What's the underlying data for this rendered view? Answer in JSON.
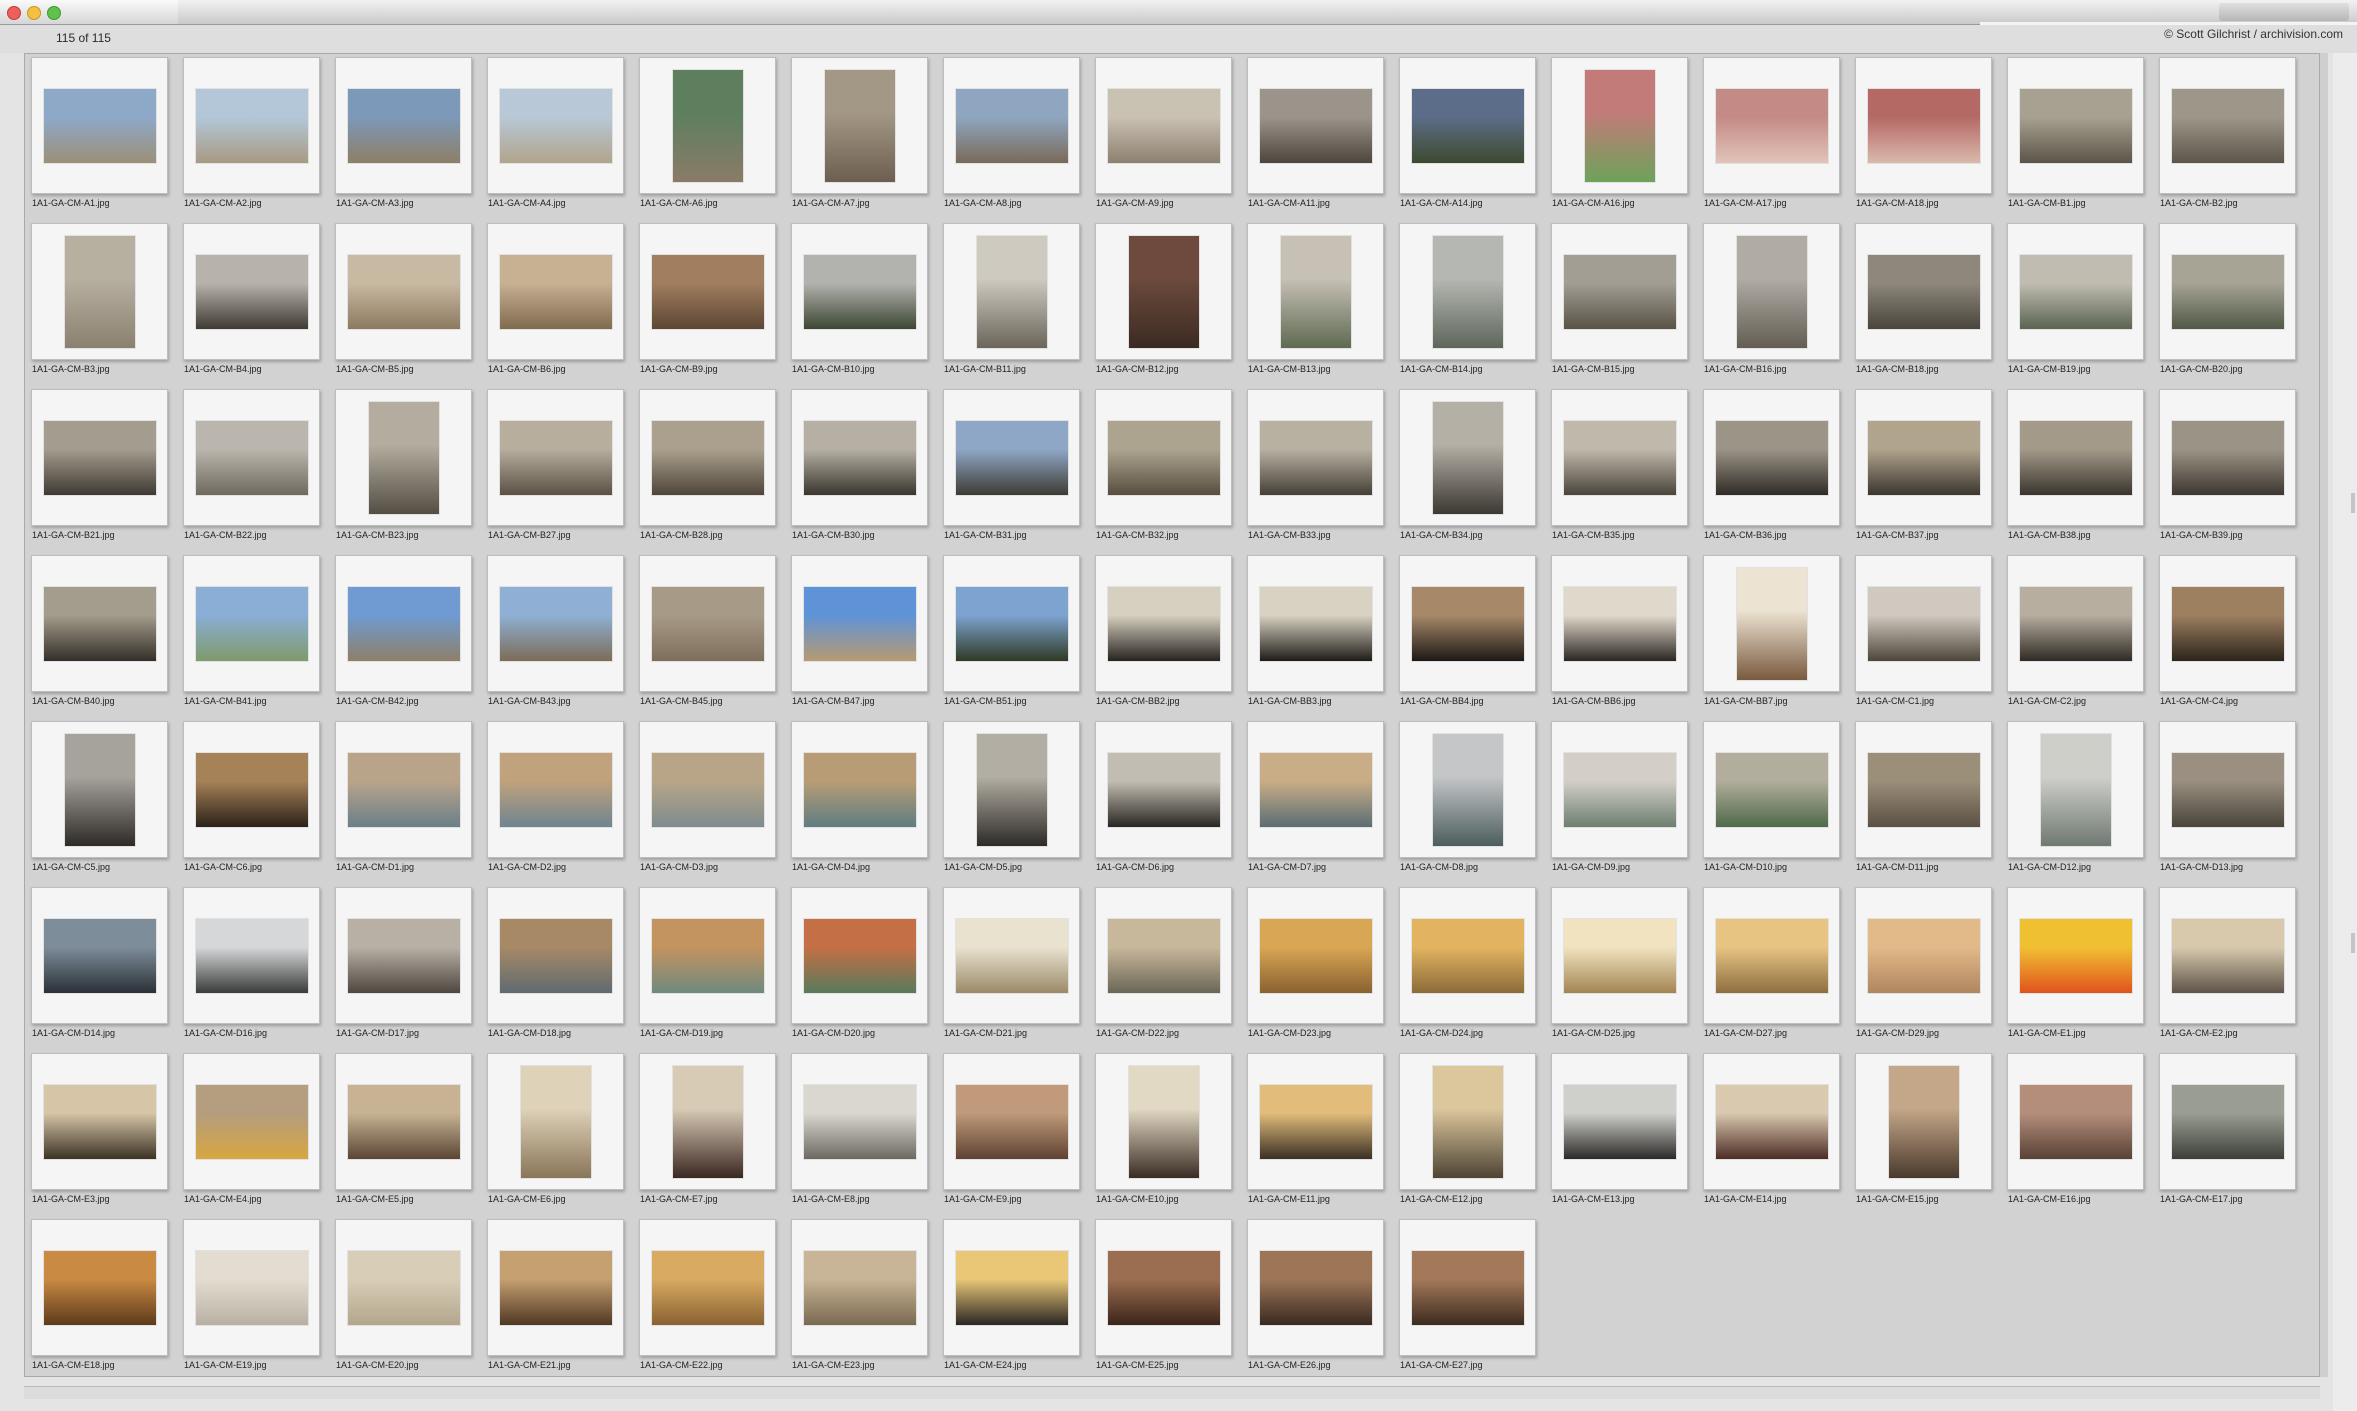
{
  "window": {
    "count_label": "115 of 115",
    "credit": "© Scott Gilchrist / archivision.com"
  },
  "thumbnails": [
    {
      "name": "1A1-GA-CM-A1.jpg",
      "c1": "#8ea9c8",
      "c2": "#9b8f78",
      "o": "l"
    },
    {
      "name": "1A1-GA-CM-A2.jpg",
      "c1": "#b3c7d8",
      "c2": "#a89a82",
      "o": "l"
    },
    {
      "name": "1A1-GA-CM-A3.jpg",
      "c1": "#7c99b9",
      "c2": "#8d7f66",
      "o": "l"
    },
    {
      "name": "1A1-GA-CM-A4.jpg",
      "c1": "#b8c8d6",
      "c2": "#b0a48c",
      "o": "l"
    },
    {
      "name": "1A1-GA-CM-A6.jpg",
      "c1": "#5d7f5e",
      "c2": "#8a7b68",
      "o": "p"
    },
    {
      "name": "1A1-GA-CM-A7.jpg",
      "c1": "#a39785",
      "c2": "#6d5f50",
      "o": "p"
    },
    {
      "name": "1A1-GA-CM-A8.jpg",
      "c1": "#8ea6c0",
      "c2": "#7a6a58",
      "o": "l"
    },
    {
      "name": "1A1-GA-CM-A9.jpg",
      "c1": "#c9c1b2",
      "c2": "#8d8070",
      "o": "l"
    },
    {
      "name": "1A1-GA-CM-A11.jpg",
      "c1": "#9b948a",
      "c2": "#4e463c",
      "o": "l"
    },
    {
      "name": "1A1-GA-CM-A14.jpg",
      "c1": "#5b6d88",
      "c2": "#3d4a2e",
      "o": "l"
    },
    {
      "name": "1A1-GA-CM-A16.jpg",
      "c1": "#c27b78",
      "c2": "#6da25a",
      "o": "p"
    },
    {
      "name": "1A1-GA-CM-A17.jpg",
      "c1": "#c48a86",
      "c2": "#e1c4b8",
      "o": "l"
    },
    {
      "name": "1A1-GA-CM-A18.jpg",
      "c1": "#b56965",
      "c2": "#dab9ac",
      "o": "l"
    },
    {
      "name": "1A1-GA-CM-B1.jpg",
      "c1": "#a8a090",
      "c2": "#5c5448",
      "o": "l"
    },
    {
      "name": "1A1-GA-CM-B2.jpg",
      "c1": "#9c9789",
      "c2": "#5c564a",
      "o": "l"
    },
    {
      "name": "1A1-GA-CM-B3.jpg",
      "c1": "#b7afa0",
      "c2": "#8a8170",
      "o": "p"
    },
    {
      "name": "1A1-GA-CM-B4.jpg",
      "c1": "#b8b3aa",
      "c2": "#3f3a33",
      "o": "l"
    },
    {
      "name": "1A1-GA-CM-B5.jpg",
      "c1": "#c8b9a2",
      "c2": "#8d7a60",
      "o": "l"
    },
    {
      "name": "1A1-GA-CM-B6.jpg",
      "c1": "#c7b193",
      "c2": "#806b4f",
      "o": "l"
    },
    {
      "name": "1A1-GA-CM-B9.jpg",
      "c1": "#a07e5f",
      "c2": "#5d4633",
      "o": "l"
    },
    {
      "name": "1A1-GA-CM-B10.jpg",
      "c1": "#b2b2ae",
      "c2": "#3d4732",
      "o": "l"
    },
    {
      "name": "1A1-GA-CM-B11.jpg",
      "c1": "#cfcac0",
      "c2": "#6b655a",
      "o": "p"
    },
    {
      "name": "1A1-GA-CM-B12.jpg",
      "c1": "#6d4a3d",
      "c2": "#3b2a22",
      "o": "p"
    },
    {
      "name": "1A1-GA-CM-B13.jpg",
      "c1": "#c6c0b5",
      "c2": "#5f6a52",
      "o": "p"
    },
    {
      "name": "1A1-GA-CM-B14.jpg",
      "c1": "#b5b8b2",
      "c2": "#5e665a",
      "o": "p"
    },
    {
      "name": "1A1-GA-CM-B15.jpg",
      "c1": "#a29e94",
      "c2": "#595246",
      "o": "l"
    },
    {
      "name": "1A1-GA-CM-B16.jpg",
      "c1": "#b0aca3",
      "c2": "#635d54",
      "o": "p"
    },
    {
      "name": "1A1-GA-CM-B18.jpg",
      "c1": "#8d877c",
      "c2": "#4a453d",
      "o": "l"
    },
    {
      "name": "1A1-GA-CM-B19.jpg",
      "c1": "#c1bcb1",
      "c2": "#5a6451",
      "o": "l"
    },
    {
      "name": "1A1-GA-CM-B20.jpg",
      "c1": "#a7a395",
      "c2": "#4f5a45",
      "o": "l"
    },
    {
      "name": "1A1-GA-CM-B21.jpg",
      "c1": "#a39c8f",
      "c2": "#3f3a33",
      "o": "l"
    },
    {
      "name": "1A1-GA-CM-B22.jpg",
      "c1": "#bab6ad",
      "c2": "#6f6a60",
      "o": "l"
    },
    {
      "name": "1A1-GA-CM-B23.jpg",
      "c1": "#b4ad9f",
      "c2": "#544e44",
      "o": "p"
    },
    {
      "name": "1A1-GA-CM-B27.jpg",
      "c1": "#b7ae9e",
      "c2": "#5b5145",
      "o": "l"
    },
    {
      "name": "1A1-GA-CM-B28.jpg",
      "c1": "#aaa08d",
      "c2": "#4f463a",
      "o": "l"
    },
    {
      "name": "1A1-GA-CM-B30.jpg",
      "c1": "#b6b0a4",
      "c2": "#39362f",
      "o": "l"
    },
    {
      "name": "1A1-GA-CM-B31.jpg",
      "c1": "#8fa7c6",
      "c2": "#3e3b35",
      "o": "l"
    },
    {
      "name": "1A1-GA-CM-B32.jpg",
      "c1": "#ada48f",
      "c2": "#584e40",
      "o": "l"
    },
    {
      "name": "1A1-GA-CM-B33.jpg",
      "c1": "#b8b1a2",
      "c2": "#454037",
      "o": "l"
    },
    {
      "name": "1A1-GA-CM-B34.jpg",
      "c1": "#b5b0a6",
      "c2": "#3c3832",
      "o": "p"
    },
    {
      "name": "1A1-GA-CM-B35.jpg",
      "c1": "#c0b9ab",
      "c2": "#4a453c",
      "o": "l"
    },
    {
      "name": "1A1-GA-CM-B36.jpg",
      "c1": "#9c9487",
      "c2": "#2f2b26",
      "o": "l"
    },
    {
      "name": "1A1-GA-CM-B37.jpg",
      "c1": "#b1a48d",
      "c2": "#3b3630",
      "o": "l"
    },
    {
      "name": "1A1-GA-CM-B38.jpg",
      "c1": "#a39a89",
      "c2": "#3a352e",
      "o": "l"
    },
    {
      "name": "1A1-GA-CM-B39.jpg",
      "c1": "#9b9486",
      "c2": "#3c3731",
      "o": "l"
    },
    {
      "name": "1A1-GA-CM-B40.jpg",
      "c1": "#a49c8c",
      "c2": "#332f29",
      "o": "l"
    },
    {
      "name": "1A1-GA-CM-B41.jpg",
      "c1": "#8aaed6",
      "c2": "#7f9a6a",
      "o": "l"
    },
    {
      "name": "1A1-GA-CM-B42.jpg",
      "c1": "#6f9bd2",
      "c2": "#8e7f69",
      "o": "l"
    },
    {
      "name": "1A1-GA-CM-B43.jpg",
      "c1": "#8fb0d4",
      "c2": "#7c6c57",
      "o": "l"
    },
    {
      "name": "1A1-GA-CM-B45.jpg",
      "c1": "#a79a86",
      "c2": "#7e6f5c",
      "o": "l"
    },
    {
      "name": "1A1-GA-CM-B47.jpg",
      "c1": "#5e93d8",
      "c2": "#b79a72",
      "o": "l"
    },
    {
      "name": "1A1-GA-CM-B51.jpg",
      "c1": "#7da3d0",
      "c2": "#2f3a25",
      "o": "l"
    },
    {
      "name": "1A1-GA-CM-BB2.jpg",
      "c1": "#d7d0c0",
      "c2": "#27231f",
      "o": "l"
    },
    {
      "name": "1A1-GA-CM-BB3.jpg",
      "c1": "#d9d2c3",
      "c2": "#1f1c19",
      "o": "l"
    },
    {
      "name": "1A1-GA-CM-BB4.jpg",
      "c1": "#a7896a",
      "c2": "#1d1915",
      "o": "l"
    },
    {
      "name": "1A1-GA-CM-BB6.jpg",
      "c1": "#e0d9cb",
      "c2": "#2b2723",
      "o": "l"
    },
    {
      "name": "1A1-GA-CM-BB7.jpg",
      "c1": "#ece3d2",
      "c2": "#7a5a3e",
      "o": "p"
    },
    {
      "name": "1A1-GA-CM-C1.jpg",
      "c1": "#cfc9bf",
      "c2": "#4e463b",
      "o": "l"
    },
    {
      "name": "1A1-GA-CM-C2.jpg",
      "c1": "#b7aea0",
      "c2": "#2f2a24",
      "o": "l"
    },
    {
      "name": "1A1-GA-CM-C4.jpg",
      "c1": "#9d8060",
      "c2": "#2c241c",
      "o": "l"
    },
    {
      "name": "1A1-GA-CM-C5.jpg",
      "c1": "#a6a39d",
      "c2": "#2e2b27",
      "o": "p"
    },
    {
      "name": "1A1-GA-CM-C6.jpg",
      "c1": "#a58258",
      "c2": "#2c2219",
      "o": "l"
    },
    {
      "name": "1A1-GA-CM-D1.jpg",
      "c1": "#b9a48a",
      "c2": "#6b7f88",
      "o": "l"
    },
    {
      "name": "1A1-GA-CM-D2.jpg",
      "c1": "#c0a27c",
      "c2": "#6f8490",
      "o": "l"
    },
    {
      "name": "1A1-GA-CM-D3.jpg",
      "c1": "#b8a588",
      "c2": "#7e8c8e",
      "o": "l"
    },
    {
      "name": "1A1-GA-CM-D4.jpg",
      "c1": "#b89c76",
      "c2": "#5f7d82",
      "o": "l"
    },
    {
      "name": "1A1-GA-CM-D5.jpg",
      "c1": "#b3aea3",
      "c2": "#2e2b27",
      "o": "p"
    },
    {
      "name": "1A1-GA-CM-D6.jpg",
      "c1": "#c2bdb2",
      "c2": "#2a2723",
      "o": "l"
    },
    {
      "name": "1A1-GA-CM-D7.jpg",
      "c1": "#c9ad86",
      "c2": "#5b6d74",
      "o": "l"
    },
    {
      "name": "1A1-GA-CM-D8.jpg",
      "c1": "#c4c6c8",
      "c2": "#4d5e5d",
      "o": "p"
    },
    {
      "name": "1A1-GA-CM-D9.jpg",
      "c1": "#d3cfc7",
      "c2": "#6c7f6f",
      "o": "l"
    },
    {
      "name": "1A1-GA-CM-D10.jpg",
      "c1": "#b2ad9c",
      "c2": "#4f6a4b",
      "o": "l"
    },
    {
      "name": "1A1-GA-CM-D11.jpg",
      "c1": "#9b8f7a",
      "c2": "#5b5043",
      "o": "l"
    },
    {
      "name": "1A1-GA-CM-D12.jpg",
      "c1": "#cfcfca",
      "c2": "#6f7972",
      "o": "p"
    },
    {
      "name": "1A1-GA-CM-D13.jpg",
      "c1": "#9a8f80",
      "c2": "#4a443b",
      "o": "l"
    },
    {
      "name": "1A1-GA-CM-D14.jpg",
      "c1": "#7d8d9a",
      "c2": "#2b3036",
      "o": "l"
    },
    {
      "name": "1A1-GA-CM-D16.jpg",
      "c1": "#d6d7d8",
      "c2": "#3a3b3b",
      "o": "l"
    },
    {
      "name": "1A1-GA-CM-D17.jpg",
      "c1": "#b8b0a5",
      "c2": "#4e4740",
      "o": "l"
    },
    {
      "name": "1A1-GA-CM-D18.jpg",
      "c1": "#a78966",
      "c2": "#5f6b70",
      "o": "l"
    },
    {
      "name": "1A1-GA-CM-D19.jpg",
      "c1": "#c39360",
      "c2": "#6f8a7e",
      "o": "l"
    },
    {
      "name": "1A1-GA-CM-D20.jpg",
      "c1": "#c46f45",
      "c2": "#597a5b",
      "o": "l"
    },
    {
      "name": "1A1-GA-CM-D21.jpg",
      "c1": "#e8e2cf",
      "c2": "#9b8a68",
      "o": "l"
    },
    {
      "name": "1A1-GA-CM-D22.jpg",
      "c1": "#c8b89b",
      "c2": "#6b6656",
      "o": "l"
    },
    {
      "name": "1A1-GA-CM-D23.jpg",
      "c1": "#d9a654",
      "c2": "#8a6231",
      "o": "l"
    },
    {
      "name": "1A1-GA-CM-D24.jpg",
      "c1": "#e2b460",
      "c2": "#8c6b3a",
      "o": "l"
    },
    {
      "name": "1A1-GA-CM-D25.jpg",
      "c1": "#f1e3c0",
      "c2": "#a38552",
      "o": "l"
    },
    {
      "name": "1A1-GA-CM-D27.jpg",
      "c1": "#e8c483",
      "c2": "#8e6d41",
      "o": "l"
    },
    {
      "name": "1A1-GA-CM-D29.jpg",
      "c1": "#e2b988",
      "c2": "#b08660",
      "o": "l"
    },
    {
      "name": "1A1-GA-CM-E1.jpg",
      "c1": "#f0c033",
      "c2": "#e0531c",
      "o": "l"
    },
    {
      "name": "1A1-GA-CM-E2.jpg",
      "c1": "#d8c9ad",
      "c2": "#5d5347",
      "o": "l"
    },
    {
      "name": "1A1-GA-CM-E3.jpg",
      "c1": "#d6c5a6",
      "c2": "#3c3326",
      "o": "l"
    },
    {
      "name": "1A1-GA-CM-E4.jpg",
      "c1": "#b49e7f",
      "c2": "#d7a640",
      "o": "l"
    },
    {
      "name": "1A1-GA-CM-E5.jpg",
      "c1": "#c7b394",
      "c2": "#5b4634",
      "o": "l"
    },
    {
      "name": "1A1-GA-CM-E6.jpg",
      "c1": "#ded2b8",
      "c2": "#8a7558",
      "o": "p"
    },
    {
      "name": "1A1-GA-CM-E7.jpg",
      "c1": "#d8cbb5",
      "c2": "#3b2722",
      "o": "p"
    },
    {
      "name": "1A1-GA-CM-E8.jpg",
      "c1": "#d9d7d0",
      "c2": "#6c6962",
      "o": "l"
    },
    {
      "name": "1A1-GA-CM-E9.jpg",
      "c1": "#c09a7a",
      "c2": "#5e4232",
      "o": "l"
    },
    {
      "name": "1A1-GA-CM-E10.jpg",
      "c1": "#e2d9c4",
      "c2": "#3a2c24",
      "o": "p"
    },
    {
      "name": "1A1-GA-CM-E11.jpg",
      "c1": "#e1bc7a",
      "c2": "#3b3024",
      "o": "l"
    },
    {
      "name": "1A1-GA-CM-E12.jpg",
      "c1": "#dcc79c",
      "c2": "#4e4434",
      "o": "p"
    },
    {
      "name": "1A1-GA-CM-E13.jpg",
      "c1": "#cfcfcb",
      "c2": "#2b2a28",
      "o": "l"
    },
    {
      "name": "1A1-GA-CM-E14.jpg",
      "c1": "#d9c9af",
      "c2": "#4d2c26",
      "o": "l"
    },
    {
      "name": "1A1-GA-CM-E15.jpg",
      "c1": "#c4a788",
      "c2": "#4a3a2d",
      "o": "p"
    },
    {
      "name": "1A1-GA-CM-E16.jpg",
      "c1": "#b48e7b",
      "c2": "#5a4136",
      "o": "l"
    },
    {
      "name": "1A1-GA-CM-E17.jpg",
      "c1": "#9a9d94",
      "c2": "#3d4038",
      "o": "l"
    },
    {
      "name": "1A1-GA-CM-E18.jpg",
      "c1": "#c98a43",
      "c2": "#5c3a1a",
      "o": "l"
    },
    {
      "name": "1A1-GA-CM-E19.jpg",
      "c1": "#e3ddd1",
      "c2": "#b8b0a3",
      "o": "l"
    },
    {
      "name": "1A1-GA-CM-E20.jpg",
      "c1": "#d8cdb6",
      "c2": "#b3a68d",
      "o": "l"
    },
    {
      "name": "1A1-GA-CM-E21.jpg",
      "c1": "#c5a070",
      "c2": "#4f3823",
      "o": "l"
    },
    {
      "name": "1A1-GA-CM-E22.jpg",
      "c1": "#d8aa62",
      "c2": "#8a6232",
      "o": "l"
    },
    {
      "name": "1A1-GA-CM-E23.jpg",
      "c1": "#c8b496",
      "c2": "#7a6a52",
      "o": "l"
    },
    {
      "name": "1A1-GA-CM-E24.jpg",
      "c1": "#e9c777",
      "c2": "#2a2622",
      "o": "l"
    },
    {
      "name": "1A1-GA-CM-E25.jpg",
      "c1": "#9c6e51",
      "c2": "#3b2519",
      "o": "l"
    },
    {
      "name": "1A1-GA-CM-E26.jpg",
      "c1": "#9d7658",
      "c2": "#3a2a20",
      "o": "l"
    },
    {
      "name": "1A1-GA-CM-E27.jpg",
      "c1": "#a4795a",
      "c2": "#3d2b1f",
      "o": "l"
    }
  ]
}
